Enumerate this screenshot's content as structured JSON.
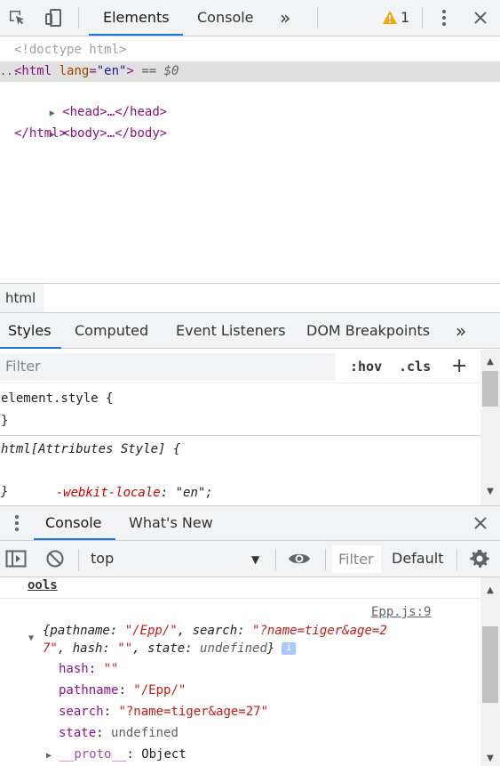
{
  "toolbar": {
    "tabs": [
      "Elements",
      "Console"
    ],
    "more": "»",
    "warning_count": "1"
  },
  "elements": {
    "doctype": "<!doctype html>",
    "html_open_tag": "<html",
    "lang_attr": "lang",
    "lang_value": "\"en\"",
    "selected_marker": " == $0",
    "head": "<head>…</head>",
    "body": "<body>…</body>",
    "html_close": "</html>",
    "dots": "..."
  },
  "breadcrumb": {
    "item": "html"
  },
  "styles_tabs": [
    "Styles",
    "Computed",
    "Event Listeners",
    "DOM Breakpoints"
  ],
  "styles_more": "»",
  "filter": {
    "placeholder": "Filter",
    "hov": ":hov",
    "cls": ".cls",
    "add": "+"
  },
  "styles": {
    "rule1_selector": "element.style {",
    "rule1_close": "}",
    "rule2_selector": "html[Attributes Style] {",
    "rule2_prop": "-webkit-locale",
    "rule2_value": "\"en\";",
    "rule2_close": "}"
  },
  "drawer": {
    "tabs": [
      "Console",
      "What's New"
    ]
  },
  "console_toolbar": {
    "context": "top",
    "filter_placeholder": "Filter",
    "levels": "Default"
  },
  "console": {
    "partial_top": "ools",
    "source_link": "Epp.js:9",
    "obj_line1_a": "{pathname: ",
    "obj_line1_b": "\"/Epp/\"",
    "obj_line1_c": ", search: ",
    "obj_line1_d": "\"?name=tiger&age=2",
    "obj_line2_a": "7\"",
    "obj_line2_b": ", hash: ",
    "obj_line2_c": "\"\"",
    "obj_line2_d": ", state: ",
    "obj_line2_e": "undefined",
    "obj_line2_f": "}",
    "info_badge": "i",
    "props": [
      {
        "key": "hash",
        "value": "\"\""
      },
      {
        "key": "pathname",
        "value": "\"/Epp/\""
      },
      {
        "key": "search",
        "value": "\"?name=tiger&age=27\""
      },
      {
        "key": "state",
        "value": "undefined"
      },
      {
        "key": "__proto__",
        "value": "Object"
      }
    ]
  },
  "colors": {
    "accent": "#1a73e8",
    "tag": "#881280",
    "attr": "#994500",
    "attr_value": "#1a1aa6",
    "warning": "#f2a600",
    "string": "#c41a16"
  }
}
